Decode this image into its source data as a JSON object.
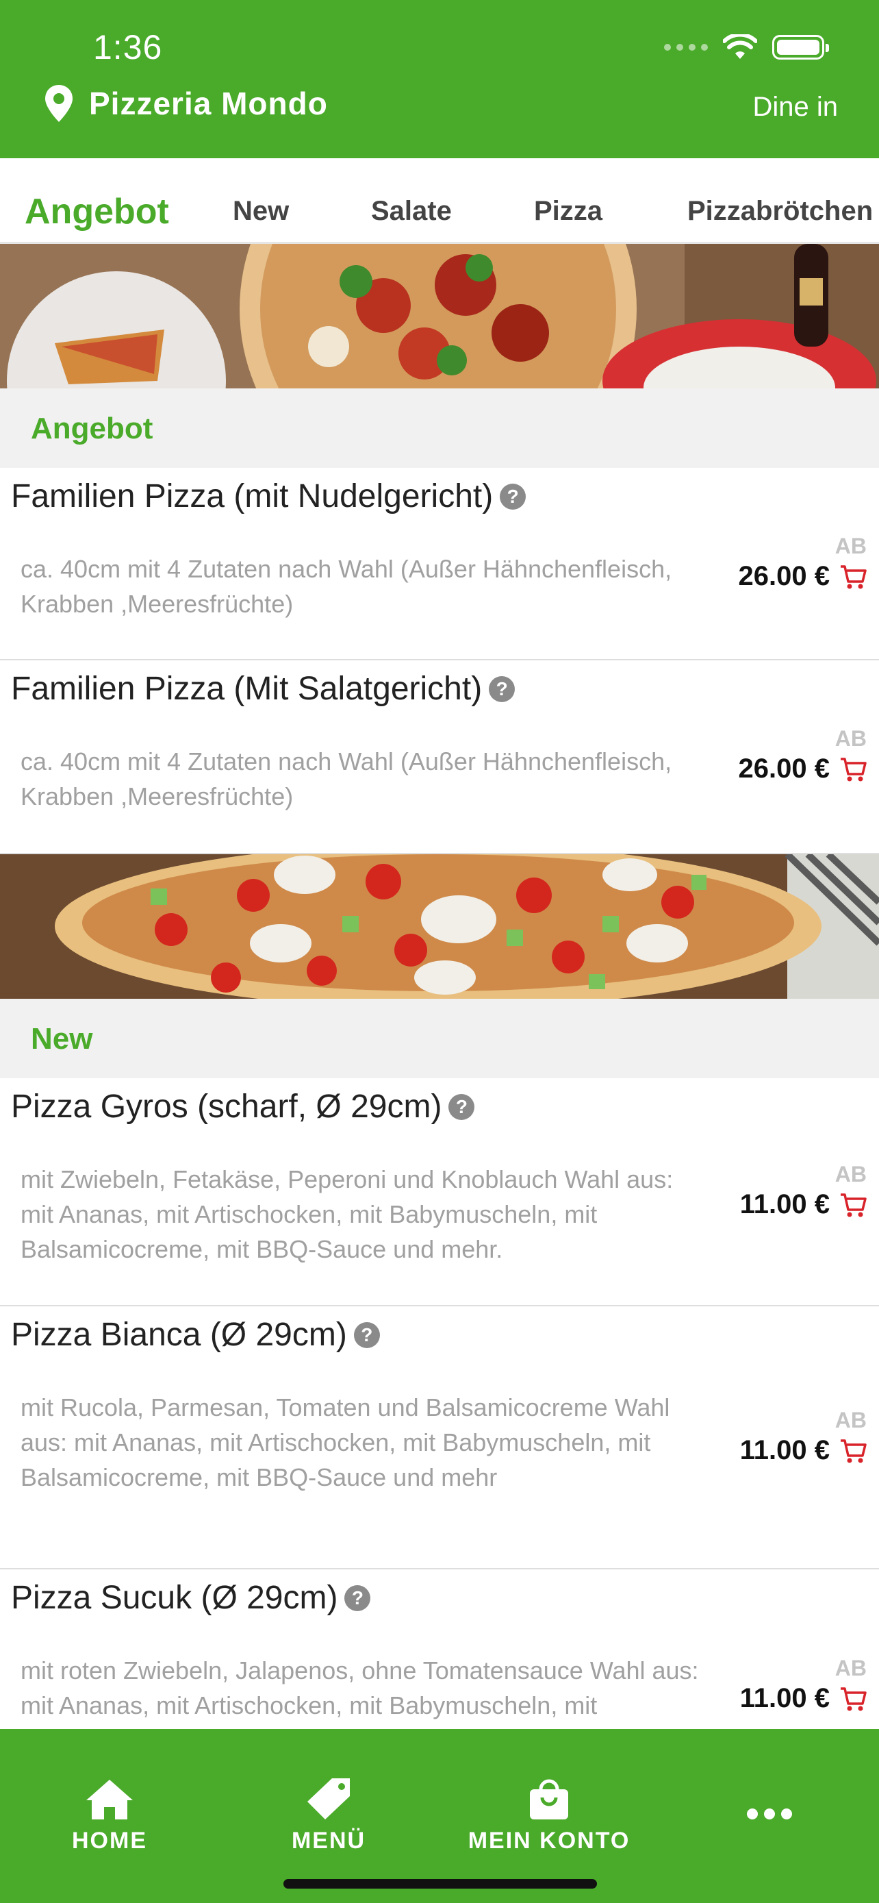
{
  "status_bar": {
    "time": "1:36"
  },
  "header": {
    "store_name": "Pizzeria Mondo",
    "order_mode": "Dine in"
  },
  "tabs": [
    {
      "label": "Angebot",
      "active": true
    },
    {
      "label": "New",
      "active": false
    },
    {
      "label": "Salate",
      "active": false
    },
    {
      "label": "Pizza",
      "active": false
    },
    {
      "label": "Pizzabrötchen",
      "active": false
    }
  ],
  "sections": [
    {
      "title": "Angebot",
      "items": [
        {
          "name": "Familien Pizza (mit Nudelgericht)",
          "description": "ca. 40cm mit 4 Zutaten nach Wahl (Außer Hähnchenfleisch, Krabben ,Meeresfrüchte)",
          "price_prefix": "AB",
          "price": "26.00 €"
        },
        {
          "name": "Familien Pizza (Mit Salatgericht)",
          "description": "ca. 40cm mit 4 Zutaten nach Wahl (Außer Hähnchenfleisch, Krabben ,Meeresfrüchte)",
          "price_prefix": "AB",
          "price": "26.00 €"
        }
      ]
    },
    {
      "title": "New",
      "items": [
        {
          "name": "Pizza Gyros (scharf, Ø 29cm)",
          "description": "mit Zwiebeln, Fetakäse, Peperoni und Knoblauch Wahl aus: mit Ananas, mit Artischocken, mit Babymuscheln, mit Balsamicocreme, mit BBQ-Sauce und mehr.",
          "price_prefix": "AB",
          "price": "11.00 €"
        },
        {
          "name": "Pizza Bianca (Ø 29cm)",
          "description": "mit Rucola, Parmesan, Tomaten und Balsamicocreme Wahl aus: mit Ananas, mit Artischocken, mit Babymuscheln, mit Balsamicocreme, mit BBQ-Sauce und mehr",
          "price_prefix": "AB",
          "price": "11.00 €"
        },
        {
          "name": "Pizza Sucuk (Ø 29cm)",
          "description": "mit roten Zwiebeln, Jalapenos, ohne Tomatensauce Wahl aus: mit Ananas, mit Artischocken, mit Babymuscheln, mit",
          "price_prefix": "AB",
          "price": "11.00 €"
        }
      ]
    }
  ],
  "help_glyph": "?",
  "bottom_nav": [
    {
      "label": "HOME",
      "icon": "home-icon"
    },
    {
      "label": "MENÜ",
      "icon": "tag-icon"
    },
    {
      "label": "MEIN KONTO",
      "icon": "bag-icon"
    },
    {
      "label": "",
      "icon": "more-icon"
    }
  ],
  "colors": {
    "brand_green": "#4aaa2a",
    "cart_red": "#d8232a",
    "muted_text": "#a0a0a0"
  }
}
